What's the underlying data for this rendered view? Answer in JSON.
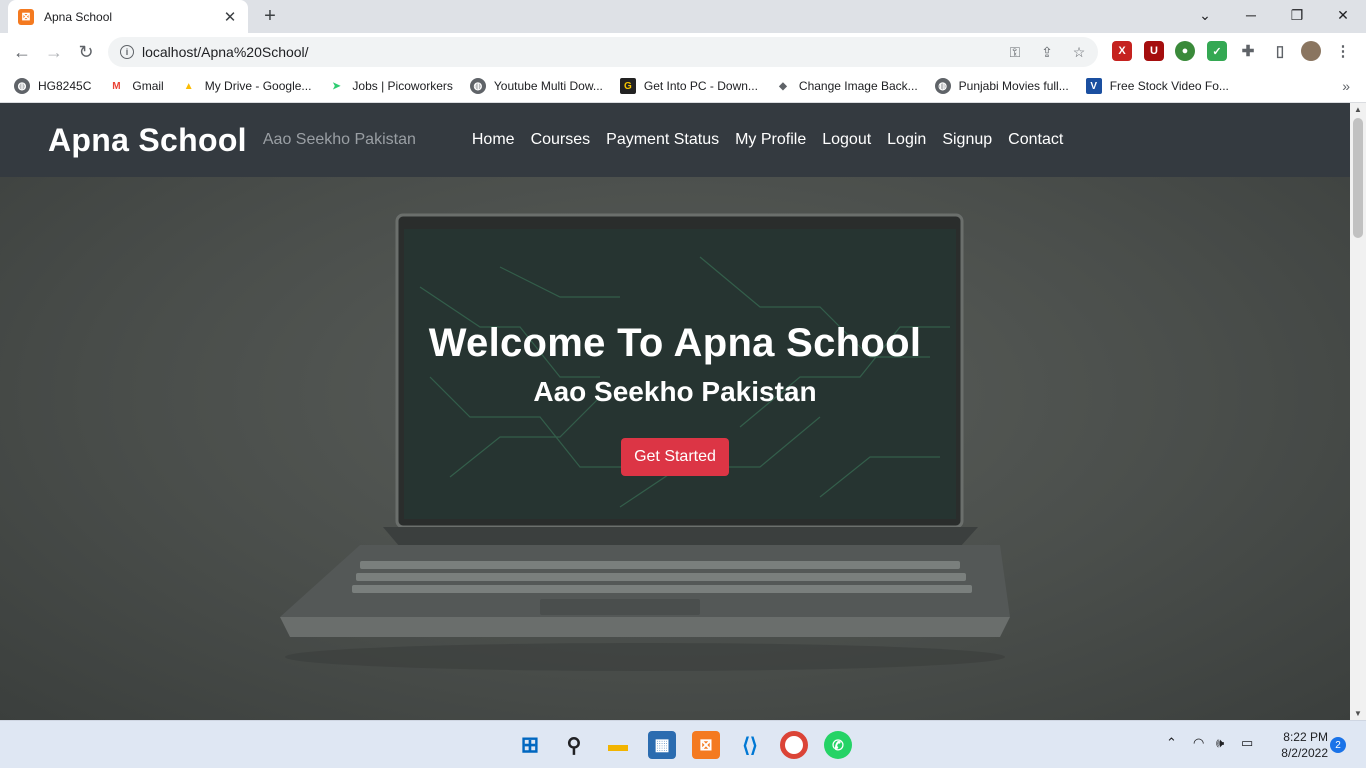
{
  "browser": {
    "tab_title": "Apna School",
    "tab_favicon": "xampp-icon",
    "url": "localhost/Apna%20School/",
    "new_tab": "+",
    "close_tab": "✕",
    "bookmarks": [
      {
        "label": "HG8245C",
        "icon": "globe-icon"
      },
      {
        "label": "Gmail",
        "icon": "gmail-icon"
      },
      {
        "label": "My Drive - Google...",
        "icon": "drive-icon"
      },
      {
        "label": "Jobs | Picoworkers",
        "icon": "send-icon"
      },
      {
        "label": "Youtube Multi Dow...",
        "icon": "globe-icon"
      },
      {
        "label": "Get Into PC - Down...",
        "icon": "g-icon"
      },
      {
        "label": "Change Image Back...",
        "icon": "layers-icon"
      },
      {
        "label": "Punjabi Movies full...",
        "icon": "globe-icon"
      },
      {
        "label": "Free Stock Video Fo...",
        "icon": "v-icon"
      }
    ],
    "bookmarks_more": "»"
  },
  "site": {
    "brand": "Apna School",
    "tagline": "Aao Seekho Pakistan",
    "nav": [
      "Home",
      "Courses",
      "Payment Status",
      "My Profile",
      "Logout",
      "Login",
      "Signup",
      "Contact"
    ],
    "hero_title": "Welcome To Apna School",
    "hero_subtitle": "Aao Seekho Pakistan",
    "cta": "Get Started"
  },
  "taskbar": {
    "time": "8:22 PM",
    "date": "8/2/2022",
    "notifications": "2"
  },
  "colors": {
    "navbar": "#343a40",
    "cta": "#dc3545",
    "tab_bar": "#dee1e6"
  }
}
